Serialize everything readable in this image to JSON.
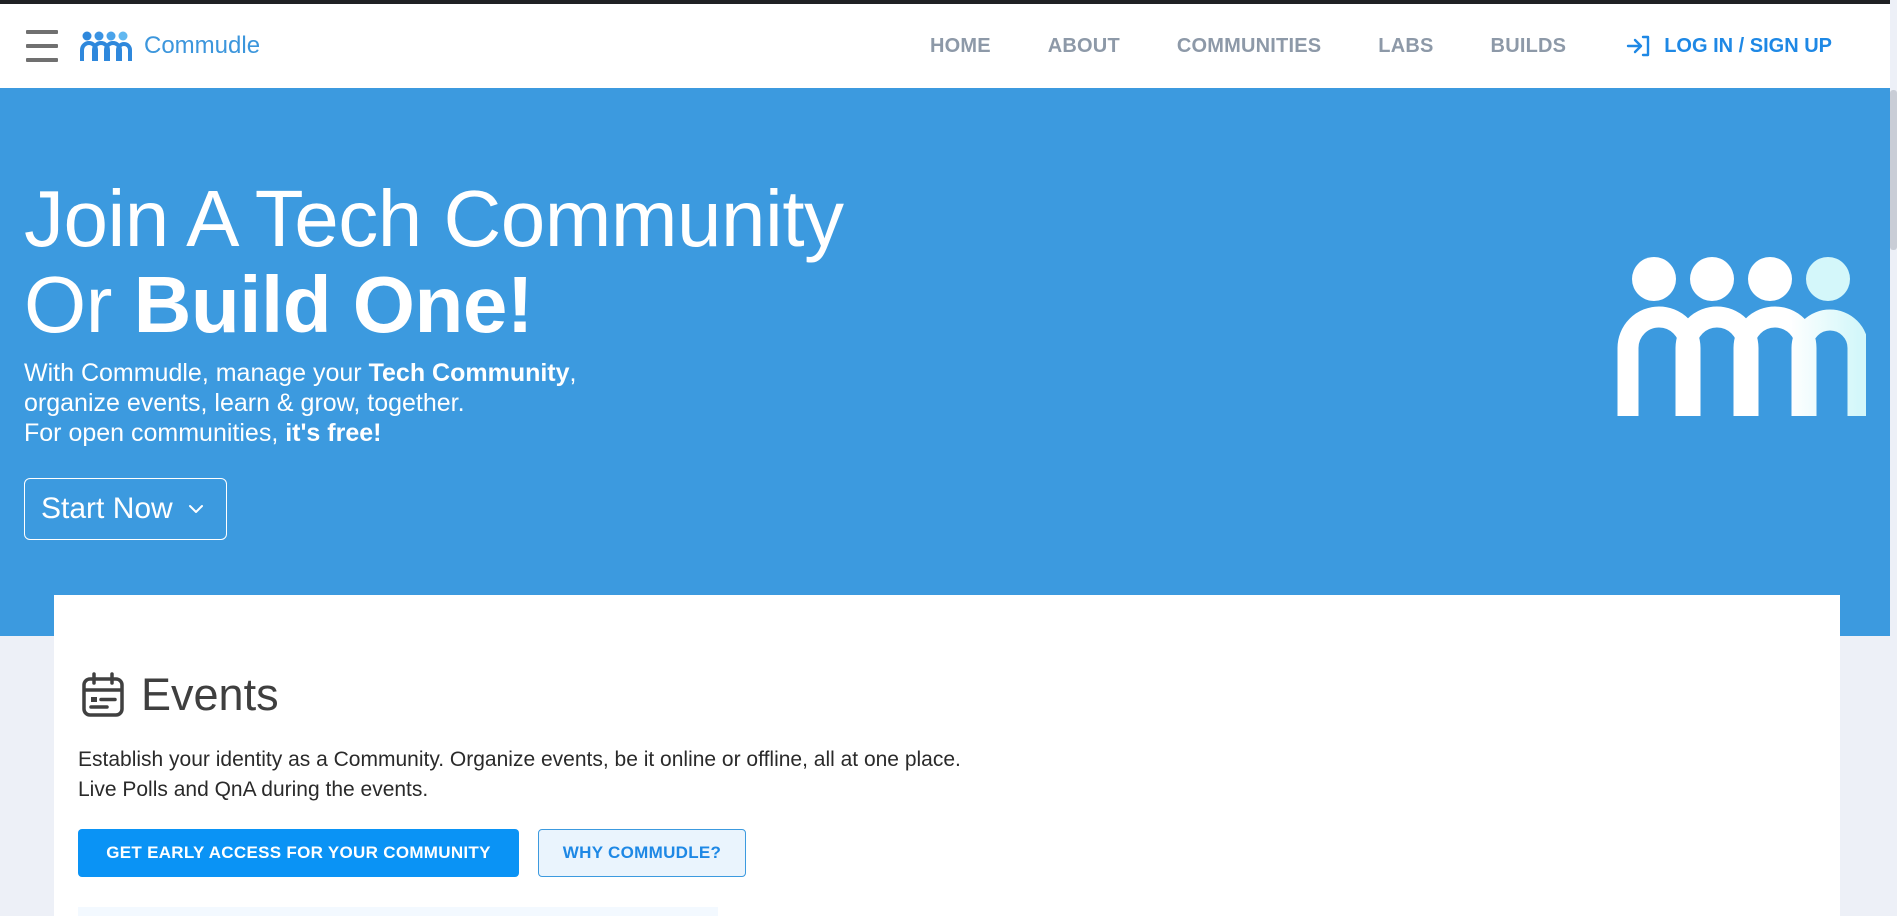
{
  "header": {
    "brand_name": "Commudle",
    "nav_items": [
      {
        "label": "HOME"
      },
      {
        "label": "ABOUT"
      },
      {
        "label": "COMMUNITIES"
      },
      {
        "label": "LABS"
      },
      {
        "label": "BUILDS"
      }
    ],
    "login_label": "LOG IN / SIGN UP"
  },
  "hero": {
    "title_line1": "Join A Tech Community",
    "title_line2_prefix": "Or ",
    "title_line2_bold": "Build One!",
    "sub_line1_prefix": "With Commudle, manage your ",
    "sub_line1_bold": "Tech Community",
    "sub_line1_suffix": ",",
    "sub_line2": "organize events, learn & grow, together.",
    "sub_line3_prefix": "For open communities, ",
    "sub_line3_bold": "it's free!",
    "start_button_label": "Start Now"
  },
  "events_card": {
    "title": "Events",
    "text_line1": "Establish your identity as a Community. Organize events, be it online or offline, all at one place.",
    "text_line2": "Live Polls and QnA during the events.",
    "primary_button_label": "GET EARLY ACCESS FOR YOUR COMMUNITY",
    "secondary_button_label": "WHY COMMUDLE?"
  },
  "icons": {
    "menu": "hamburger-menu-icon",
    "brand_logo": "commudle-logo-icon",
    "login": "login-arrow-icon",
    "chevron": "chevron-down-icon",
    "calendar": "calendar-icon"
  },
  "colors": {
    "brand_blue": "#3c9adf",
    "primary_button": "#0a93f5",
    "nav_gray": "#8d99a8",
    "link_blue": "#1e88e5"
  }
}
